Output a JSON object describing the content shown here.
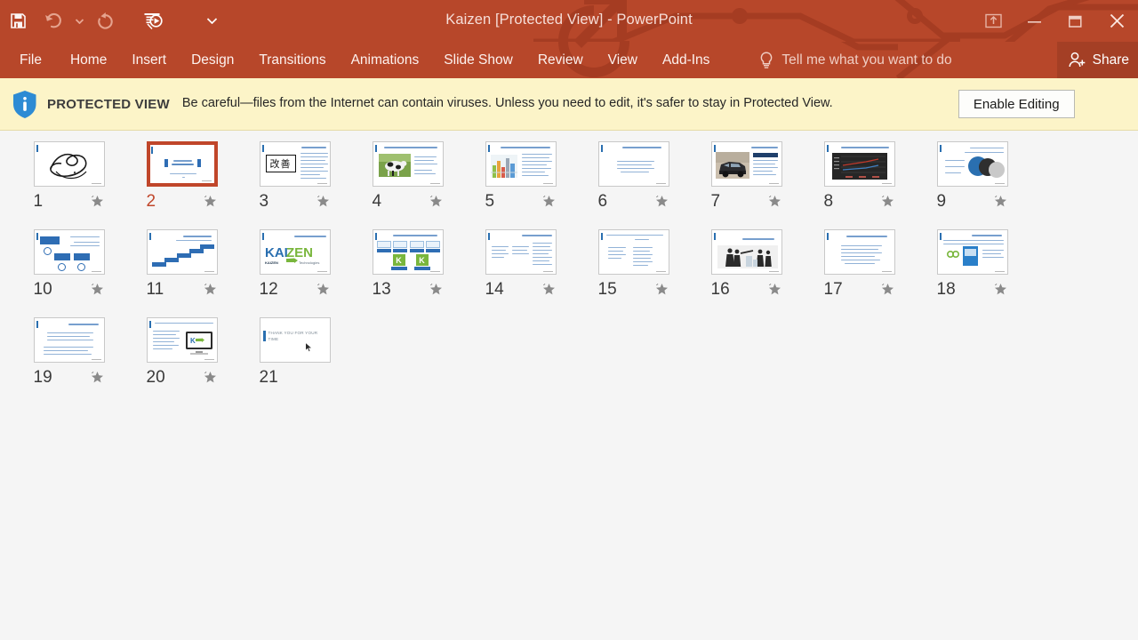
{
  "window": {
    "title": "Kaizen [Protected View] - PowerPoint",
    "accent_color": "#b7472a",
    "quick_access": [
      {
        "name": "save",
        "icon": "save-icon"
      },
      {
        "name": "undo",
        "icon": "undo-icon"
      },
      {
        "name": "redo",
        "icon": "redo-icon"
      },
      {
        "name": "start-from-beginning",
        "icon": "present-icon"
      },
      {
        "name": "customize-quick-access-toolbar",
        "icon": "chevron-down-icon"
      }
    ],
    "controls": [
      {
        "name": "ribbon-display-options",
        "icon": "ribbon-options-icon"
      },
      {
        "name": "minimize",
        "icon": "minimize-icon"
      },
      {
        "name": "restore",
        "icon": "restore-icon"
      },
      {
        "name": "close",
        "icon": "close-icon"
      }
    ]
  },
  "ribbon": {
    "tabs": [
      {
        "label": "File"
      },
      {
        "label": "Home"
      },
      {
        "label": "Insert"
      },
      {
        "label": "Design"
      },
      {
        "label": "Transitions"
      },
      {
        "label": "Animations"
      },
      {
        "label": "Slide Show"
      },
      {
        "label": "Review"
      },
      {
        "label": "View"
      },
      {
        "label": "Add-Ins"
      }
    ],
    "tell_me": "Tell me what you want to do",
    "share_label": "Share"
  },
  "protected_view": {
    "label": "PROTECTED VIEW",
    "message": "Be careful—files from the Internet can contain viruses. Unless you need to edit, it's safer to stay in Protected View.",
    "button": "Enable Editing",
    "background_color": "#fcf4c8",
    "icon": "info-shield-icon"
  },
  "slide_sorter": {
    "selected_slide": 2,
    "selection_color": "#c0462a",
    "star_icon": "star-icon",
    "slides": [
      {
        "number": "1",
        "kind": "calligraphy",
        "starred": true
      },
      {
        "number": "2",
        "kind": "title",
        "starred": true
      },
      {
        "number": "3",
        "kind": "kanji",
        "starred": true
      },
      {
        "number": "4",
        "kind": "photo-cow",
        "starred": true
      },
      {
        "number": "5",
        "kind": "photo-chart",
        "starred": true
      },
      {
        "number": "6",
        "kind": "text-only",
        "starred": true
      },
      {
        "number": "7",
        "kind": "photo-car",
        "starred": true
      },
      {
        "number": "8",
        "kind": "dark-chart",
        "starred": true
      },
      {
        "number": "9",
        "kind": "venn",
        "starred": true
      },
      {
        "number": "10",
        "kind": "org-chart",
        "starred": true
      },
      {
        "number": "11",
        "kind": "stairs",
        "starred": true
      },
      {
        "number": "12",
        "kind": "kaizen-logo",
        "starred": true
      },
      {
        "number": "13",
        "kind": "k-icons",
        "starred": true
      },
      {
        "number": "14",
        "kind": "three-col",
        "starred": true
      },
      {
        "number": "15",
        "kind": "two-col",
        "starred": true
      },
      {
        "number": "16",
        "kind": "photo-people",
        "starred": true
      },
      {
        "number": "17",
        "kind": "text-only",
        "starred": true
      },
      {
        "number": "18",
        "kind": "blue-tile",
        "starred": true
      },
      {
        "number": "19",
        "kind": "text-only",
        "starred": true
      },
      {
        "number": "20",
        "kind": "monitor",
        "starred": true
      },
      {
        "number": "21",
        "kind": "thank-you",
        "starred": false,
        "text": "THANK YOU FOR YOUR TIME"
      }
    ]
  }
}
